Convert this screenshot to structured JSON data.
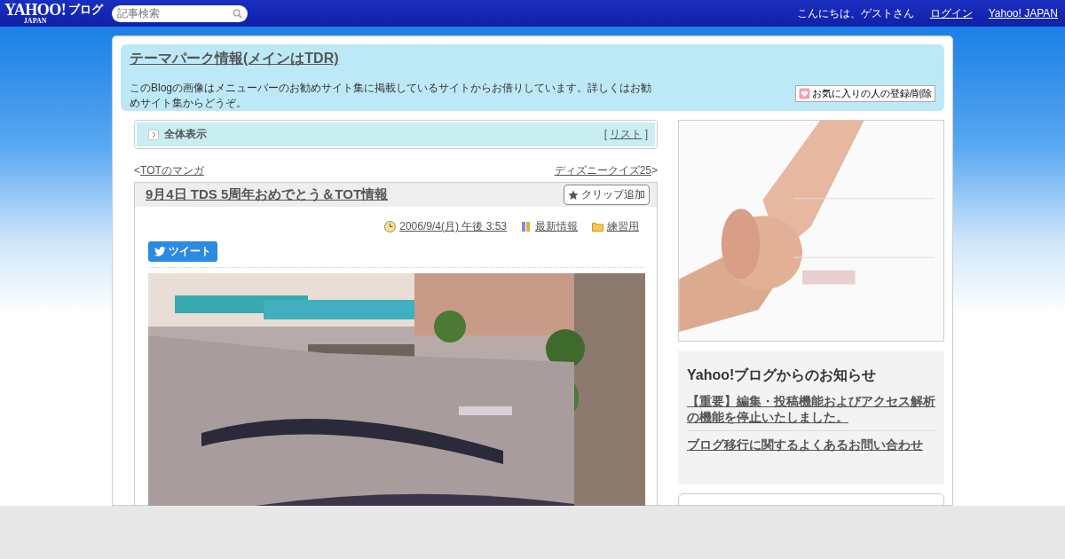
{
  "header": {
    "logo": {
      "brand": "YAHOO!",
      "region": "JAPAN",
      "service": "ブログ"
    },
    "search": {
      "placeholder": "記事検索"
    },
    "greeting": "こんにちは、ゲストさん",
    "links": [
      "ログイン",
      "Yahoo! JAPAN"
    ]
  },
  "blog": {
    "title": "テーマパーク情報(メインはTDR)",
    "description": "このBlogの画像はメニューバーのお勧めサイト集に掲載しているサイトからお借りしています。詳しくはお勧めサイト集からどうぞ。",
    "favorite_button": "お気に入りの人の登録/削除"
  },
  "view_bar": {
    "label": "全体表示",
    "list_open": "[",
    "list_link": "リスト",
    "list_close": "]"
  },
  "pager": {
    "prev_mark": "<",
    "prev": "TOTのマンガ",
    "next": "ディズニークイズ25",
    "next_mark": ">"
  },
  "article": {
    "title": "9月4日 TDS 5周年おめでとう＆TOT情報",
    "clip_button": "クリップ追加",
    "date": "2006/9/4(月) 午後 3:53",
    "category": "最新情報",
    "folder": "練習用",
    "tweet_button": "ツイート"
  },
  "sidebar": {
    "notice": {
      "title": "Yahoo!ブログからのお知らせ",
      "links": [
        "【重要】編集・投稿機能およびアクセス解析の機能を停止いたしました。",
        "ブログ移行に関するよくあるお問い合わせ"
      ]
    }
  }
}
